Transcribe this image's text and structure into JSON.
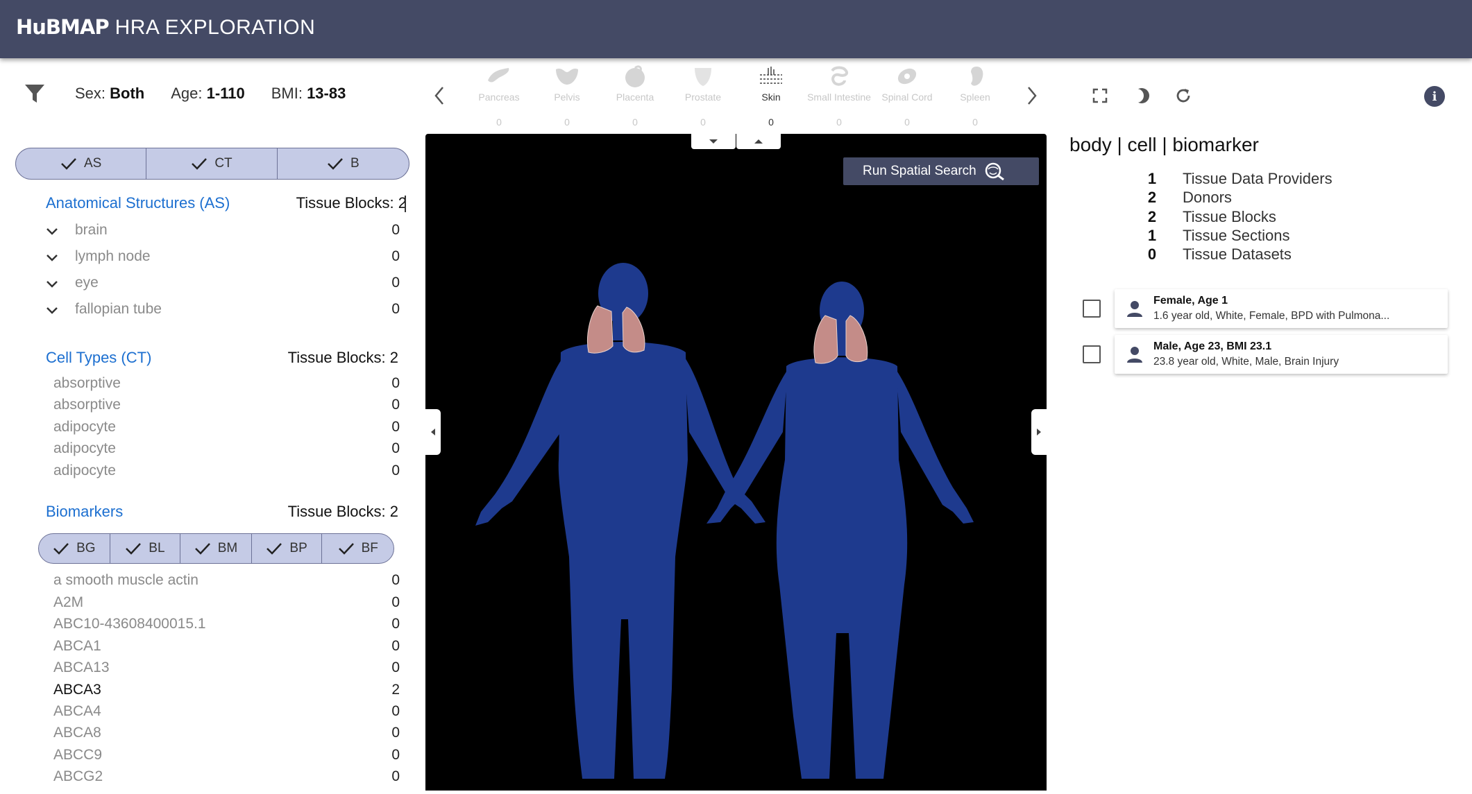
{
  "header": {
    "logo": "HuBMAP",
    "title": "HRA EXPLORATION"
  },
  "filters": {
    "sex_label": "Sex:",
    "sex_value": "Both",
    "age_label": "Age:",
    "age_value": "1-110",
    "bmi_label": "BMI:",
    "bmi_value": "13-83"
  },
  "main_toggles": [
    "AS",
    "CT",
    "B"
  ],
  "anatomical": {
    "title": "Anatomical Structures (AS)",
    "count_label": "Tissue Blocks: 2",
    "items": [
      {
        "name": "brain",
        "value": "0"
      },
      {
        "name": "lymph node",
        "value": "0"
      },
      {
        "name": "eye",
        "value": "0"
      },
      {
        "name": "fallopian tube",
        "value": "0"
      }
    ]
  },
  "cell_types": {
    "title": "Cell Types (CT)",
    "count_label": "Tissue Blocks: 2",
    "items": [
      {
        "name": "absorptive",
        "value": "0"
      },
      {
        "name": "absorptive",
        "value": "0"
      },
      {
        "name": "adipocyte",
        "value": "0"
      },
      {
        "name": "adipocyte",
        "value": "0"
      },
      {
        "name": "adipocyte",
        "value": "0"
      }
    ]
  },
  "biomarkers": {
    "title": "Biomarkers",
    "count_label": "Tissue Blocks: 2",
    "toggles": [
      "BG",
      "BL",
      "BM",
      "BP",
      "BF"
    ],
    "items": [
      {
        "name": "a smooth muscle actin",
        "value": "0"
      },
      {
        "name": "A2M",
        "value": "0"
      },
      {
        "name": "ABC10-43608400015.1",
        "value": "0"
      },
      {
        "name": "ABCA1",
        "value": "0"
      },
      {
        "name": "ABCA13",
        "value": "0"
      },
      {
        "name": "ABCA3",
        "value": "2"
      },
      {
        "name": "ABCA4",
        "value": "0"
      },
      {
        "name": "ABCA8",
        "value": "0"
      },
      {
        "name": "ABCC9",
        "value": "0"
      },
      {
        "name": "ABCG2",
        "value": "0"
      }
    ]
  },
  "organs": [
    {
      "label": "Pancreas",
      "count": "0",
      "icon": "pancreas-icon"
    },
    {
      "label": "Pelvis",
      "count": "0",
      "icon": "pelvis-icon"
    },
    {
      "label": "Placenta",
      "count": "0",
      "icon": "placenta-icon"
    },
    {
      "label": "Prostate",
      "count": "0",
      "icon": "prostate-icon"
    },
    {
      "label": "Skin",
      "count": "0",
      "icon": "skin-icon"
    },
    {
      "label": "Small Intestine",
      "count": "0",
      "icon": "small-intestine-icon"
    },
    {
      "label": "Spinal Cord",
      "count": "0",
      "icon": "spinal-cord-icon"
    },
    {
      "label": "Spleen",
      "count": "0",
      "icon": "spleen-icon"
    }
  ],
  "spatial_search": {
    "label": "Run Spatial Search"
  },
  "stats": {
    "title": "body | cell | biomarker",
    "items": [
      {
        "n": "1",
        "label": "Tissue Data Providers"
      },
      {
        "n": "2",
        "label": "Donors"
      },
      {
        "n": "2",
        "label": "Tissue Blocks"
      },
      {
        "n": "1",
        "label": "Tissue Sections"
      },
      {
        "n": "0",
        "label": "Tissue Datasets"
      }
    ]
  },
  "donors": [
    {
      "title": "Female, Age 1",
      "desc": "1.6 year old, White, Female, BPD with Pulmona..."
    },
    {
      "title": "Male, Age 23, BMI 23.1",
      "desc": "23.8 year old, White, Male, Brain Injury"
    }
  ],
  "colors": {
    "header": "#444a65",
    "accent_blue": "#1c6fd0",
    "toggle_bg": "#c5cbe6",
    "body_blue": "#1e3a8e"
  }
}
